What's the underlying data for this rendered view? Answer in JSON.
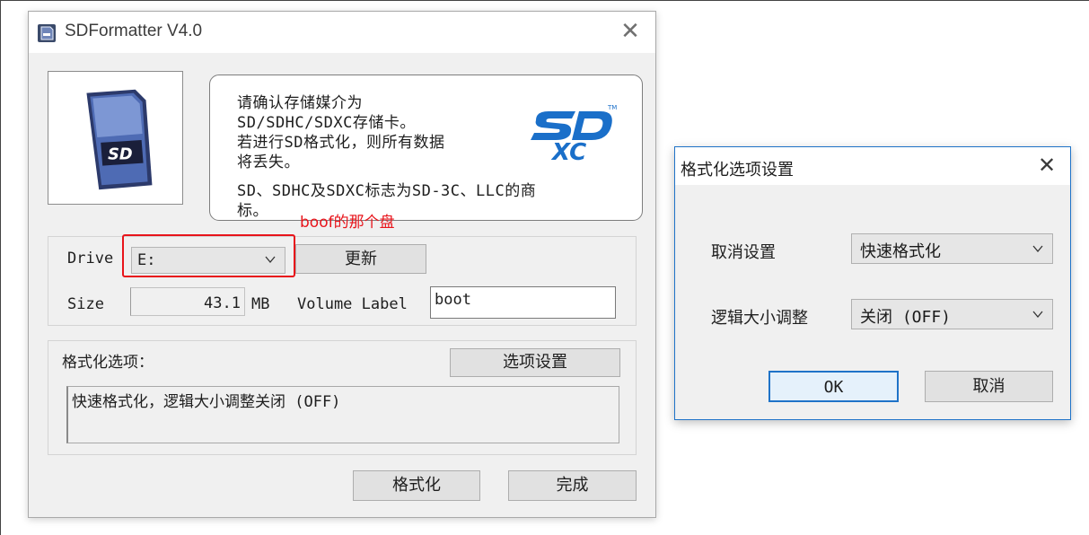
{
  "main_window": {
    "title": "SDFormatter V4.0",
    "info_lines": [
      "请确认存储媒介为",
      "SD/SDHC/SDXC存储卡。",
      "若进行SD格式化，则所有数据",
      "将丢失。",
      "SD、SDHC及SDXC标志为SD-3C、LLC的商",
      "标。"
    ],
    "drive": {
      "label": "Drive",
      "value": "E:"
    },
    "refresh_label": "更新",
    "size": {
      "label": "Size",
      "value": "43.1",
      "unit": "MB"
    },
    "volume": {
      "label": "Volume Label",
      "value": "boot"
    },
    "format_options": {
      "label": "格式化选项：",
      "button_label": "选项设置",
      "summary": "快速格式化，逻辑大小调整关闭 (OFF)"
    },
    "format_label": "格式化",
    "done_label": "完成"
  },
  "annotation": {
    "text": "boof的那个盘",
    "color": "#e8141b"
  },
  "options_dialog": {
    "title": "格式化选项设置",
    "format_type": {
      "label": "取消设置",
      "value": "快速格式化"
    },
    "size_adjust": {
      "label": "逻辑大小调整",
      "value": "关闭 (OFF)"
    },
    "ok_label": "OK",
    "cancel_label": "取消"
  },
  "icons": [
    "sd-card-app-icon",
    "close-icon",
    "sd-card-image",
    "sdxc-logo",
    "chevron-down-icon"
  ],
  "colors": {
    "accent": "#1f73c8",
    "annotation": "#e8141b",
    "dialog_bg": "#f0f0f0"
  }
}
